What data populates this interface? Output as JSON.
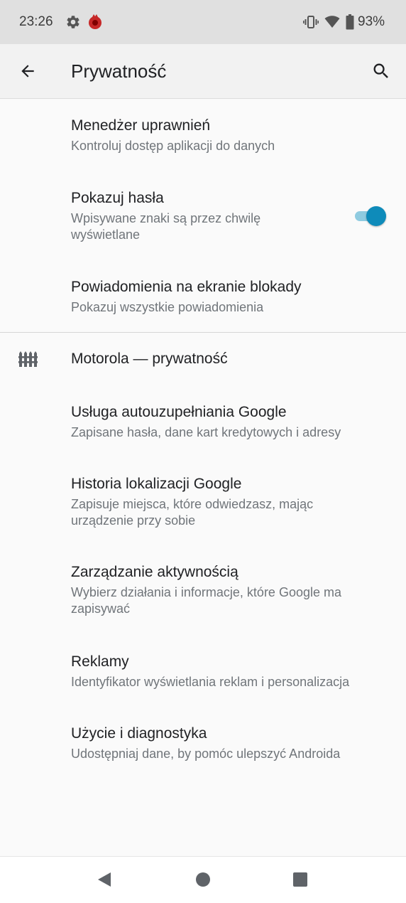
{
  "status_bar": {
    "time": "23:26",
    "battery_percent": "93%",
    "icons": [
      "settings-gear-icon",
      "app-notification-icon",
      "vibrate-icon",
      "wifi-icon",
      "battery-icon"
    ]
  },
  "app_bar": {
    "title": "Prywatność",
    "back_icon": "arrow-back-icon",
    "search_icon": "search-icon"
  },
  "items": [
    {
      "title": "Menedżer uprawnień",
      "subtitle": "Kontroluj dostęp aplikacji do danych"
    },
    {
      "title": "Pokazuj hasła",
      "subtitle_lines": [
        "Wpisywane znaki są przez chwilę",
        "wyświetlane"
      ],
      "toggle_on": true
    },
    {
      "title": "Powiadomienia na ekranie blokady",
      "subtitle": "Pokazuj wszystkie powiadomienia"
    }
  ],
  "section": {
    "title": "Motorola — prywatność",
    "icon": "fence-icon"
  },
  "section_items": [
    {
      "title": "Usługa autouzupełniania Google",
      "subtitle": "Zapisane hasła, dane kart kredytowych i adresy"
    },
    {
      "title": "Historia lokalizacji Google",
      "subtitle_lines": [
        "Zapisuje miejsca, które odwiedzasz, mając",
        "urządzenie przy sobie"
      ]
    },
    {
      "title": "Zarządzanie aktywnością",
      "subtitle_lines": [
        "Wybierz działania i informacje, które Google ma",
        "zapisywać"
      ]
    },
    {
      "title": "Reklamy",
      "subtitle": "Identyfikator wyświetlania reklam i personalizacja"
    },
    {
      "title": "Użycie i diagnostyka",
      "subtitle": "Udostępniaj dane, by pomóc ulepszyć Androida"
    }
  ],
  "colors": {
    "accent": "#0e8bba",
    "toggle_track": "#8fcbe0",
    "status_bar": "#e0e0e0",
    "app_bar": "#f2f2f2",
    "background": "#fafafa"
  },
  "nav_bar": {
    "icons": [
      "nav-back-icon",
      "nav-home-icon",
      "nav-recents-icon"
    ]
  }
}
